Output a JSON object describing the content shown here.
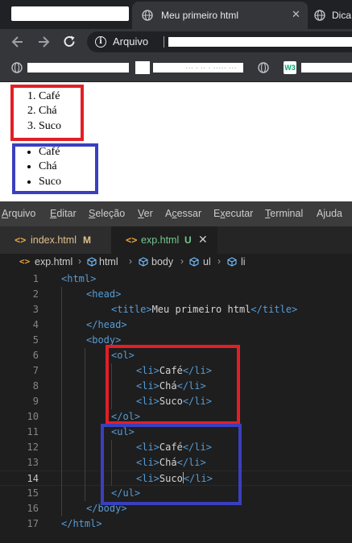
{
  "browser": {
    "active_tab": {
      "title": "Meu primeiro html",
      "close": "✕"
    },
    "second_tab": {
      "title": "Dica"
    },
    "address_bar": {
      "label": "Arquivo"
    },
    "bookmark_text": "··· · ·· · ····· ···"
  },
  "page": {
    "ordered_list": [
      "Café",
      "Chá",
      "Suco"
    ],
    "unordered_list": [
      "Café",
      "Chá",
      "Suco"
    ],
    "ordered_box_color": "#e21f26",
    "unordered_box_color": "#3a3fbf"
  },
  "vscode": {
    "menu": [
      "Arquivo",
      "Editar",
      "Seleção",
      "Ver",
      "Acessar",
      "Executar",
      "Terminal",
      "Ajuda"
    ],
    "menu_mnemonics": [
      "A",
      "E",
      "S",
      "V",
      "c",
      "x",
      "T",
      "j"
    ],
    "tabs": [
      {
        "name": "index.html",
        "flag": "M",
        "icon": "<>",
        "flag_color": "#e2c08d",
        "name_color": "#e2c08d"
      },
      {
        "name": "exp.html",
        "flag": "U",
        "icon": "<>",
        "flag_color": "#73c991",
        "name_color": "#73c991",
        "close": "✕"
      }
    ],
    "breadcrumb": [
      "exp.html",
      "html",
      "body",
      "ul",
      "li"
    ],
    "active_line": 14,
    "code_lines": [
      {
        "n": "1",
        "indent": 0,
        "tokens": [
          [
            "tag",
            "<html>"
          ]
        ]
      },
      {
        "n": "2",
        "indent": 1,
        "tokens": [
          [
            "tag",
            "<head>"
          ]
        ]
      },
      {
        "n": "3",
        "indent": 2,
        "tokens": [
          [
            "tag",
            "<title>"
          ],
          [
            "txt",
            "Meu primeiro html"
          ],
          [
            "tag",
            "</title>"
          ]
        ]
      },
      {
        "n": "4",
        "indent": 1,
        "tokens": [
          [
            "tag",
            "</head>"
          ]
        ]
      },
      {
        "n": "5",
        "indent": 1,
        "tokens": [
          [
            "tag",
            "<body>"
          ]
        ]
      },
      {
        "n": "6",
        "indent": 2,
        "tokens": [
          [
            "tag",
            "<ol>"
          ]
        ]
      },
      {
        "n": "7",
        "indent": 3,
        "tokens": [
          [
            "tag",
            "<li>"
          ],
          [
            "txt",
            "Café"
          ],
          [
            "tag",
            "</li>"
          ]
        ]
      },
      {
        "n": "8",
        "indent": 3,
        "tokens": [
          [
            "tag",
            "<li>"
          ],
          [
            "txt",
            "Chá"
          ],
          [
            "tag",
            "</li>"
          ]
        ]
      },
      {
        "n": "9",
        "indent": 3,
        "tokens": [
          [
            "tag",
            "<li>"
          ],
          [
            "txt",
            "Suco"
          ],
          [
            "tag",
            "</li>"
          ]
        ]
      },
      {
        "n": "10",
        "indent": 2,
        "tokens": [
          [
            "tag",
            "</ol>"
          ]
        ]
      },
      {
        "n": "11",
        "indent": 2,
        "tokens": [
          [
            "tag",
            "<ul>"
          ]
        ]
      },
      {
        "n": "12",
        "indent": 3,
        "tokens": [
          [
            "tag",
            "<li>"
          ],
          [
            "txt",
            "Café"
          ],
          [
            "tag",
            "</li>"
          ]
        ]
      },
      {
        "n": "13",
        "indent": 3,
        "tokens": [
          [
            "tag",
            "<li>"
          ],
          [
            "txt",
            "Chá"
          ],
          [
            "tag",
            "</li>"
          ]
        ]
      },
      {
        "n": "14",
        "indent": 3,
        "tokens": [
          [
            "tag",
            "<li>"
          ],
          [
            "txt",
            "Suco"
          ],
          [
            "cursor",
            ""
          ],
          [
            "tag",
            "</li>"
          ]
        ]
      },
      {
        "n": "15",
        "indent": 2,
        "tokens": [
          [
            "tag",
            "</ul>"
          ]
        ]
      },
      {
        "n": "16",
        "indent": 1,
        "tokens": [
          [
            "tag",
            "</body>"
          ]
        ]
      },
      {
        "n": "17",
        "indent": 0,
        "tokens": [
          [
            "tag",
            "</html>"
          ]
        ]
      }
    ],
    "colors": {
      "tag": "#569cd6",
      "text": "#d4d4d4",
      "background": "#1e1e1e"
    }
  }
}
